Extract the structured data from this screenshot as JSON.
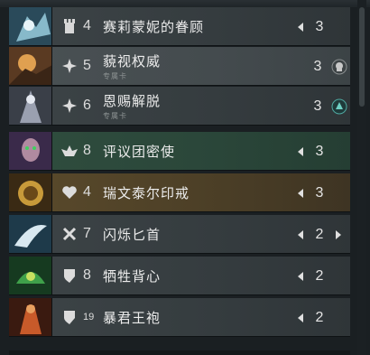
{
  "deck_rows": [
    {
      "cost": "4",
      "name": "赛莉蒙妮的眷顾",
      "subtitle": "",
      "quantity": "3",
      "type_icon": "tower-icon",
      "style": "r-default",
      "left_arrow": true,
      "right_arrow": false,
      "badge": ""
    },
    {
      "cost": "5",
      "name": "藐视权威",
      "subtitle": "专属卡",
      "quantity": "3",
      "type_icon": "spell-star-icon",
      "style": "r-selected",
      "left_arrow": false,
      "right_arrow": false,
      "badge": "hero-portrait-skull-icon"
    },
    {
      "cost": "6",
      "name": "恩赐解脱",
      "subtitle": "专属卡",
      "quantity": "3",
      "type_icon": "spell-star-icon",
      "style": "r-default",
      "left_arrow": false,
      "right_arrow": false,
      "badge": "hero-portrait-teal-icon"
    },
    {
      "cost": "8",
      "name": "评议团密使",
      "subtitle": "",
      "quantity": "3",
      "type_icon": "creep-icon",
      "style": "r-green",
      "left_arrow": true,
      "right_arrow": false,
      "badge": ""
    },
    {
      "cost": "4",
      "name": "瑞文泰尔印戒",
      "subtitle": "",
      "quantity": "3",
      "type_icon": "heart-icon",
      "style": "r-gold",
      "left_arrow": true,
      "right_arrow": false,
      "badge": ""
    },
    {
      "cost": "7",
      "name": "闪烁匕首",
      "subtitle": "",
      "quantity": "2",
      "type_icon": "crossed-swords-icon",
      "style": "r-default",
      "left_arrow": true,
      "right_arrow": true,
      "badge": ""
    },
    {
      "cost": "8",
      "name": "牺牲背心",
      "subtitle": "",
      "quantity": "2",
      "type_icon": "shield-icon",
      "style": "r-default",
      "left_arrow": true,
      "right_arrow": false,
      "badge": ""
    },
    {
      "cost": "19",
      "name": "暴君王袍",
      "subtitle": "",
      "quantity": "2",
      "type_icon": "shield-icon",
      "style": "r-default",
      "left_arrow": true,
      "right_arrow": false,
      "badge": ""
    }
  ]
}
